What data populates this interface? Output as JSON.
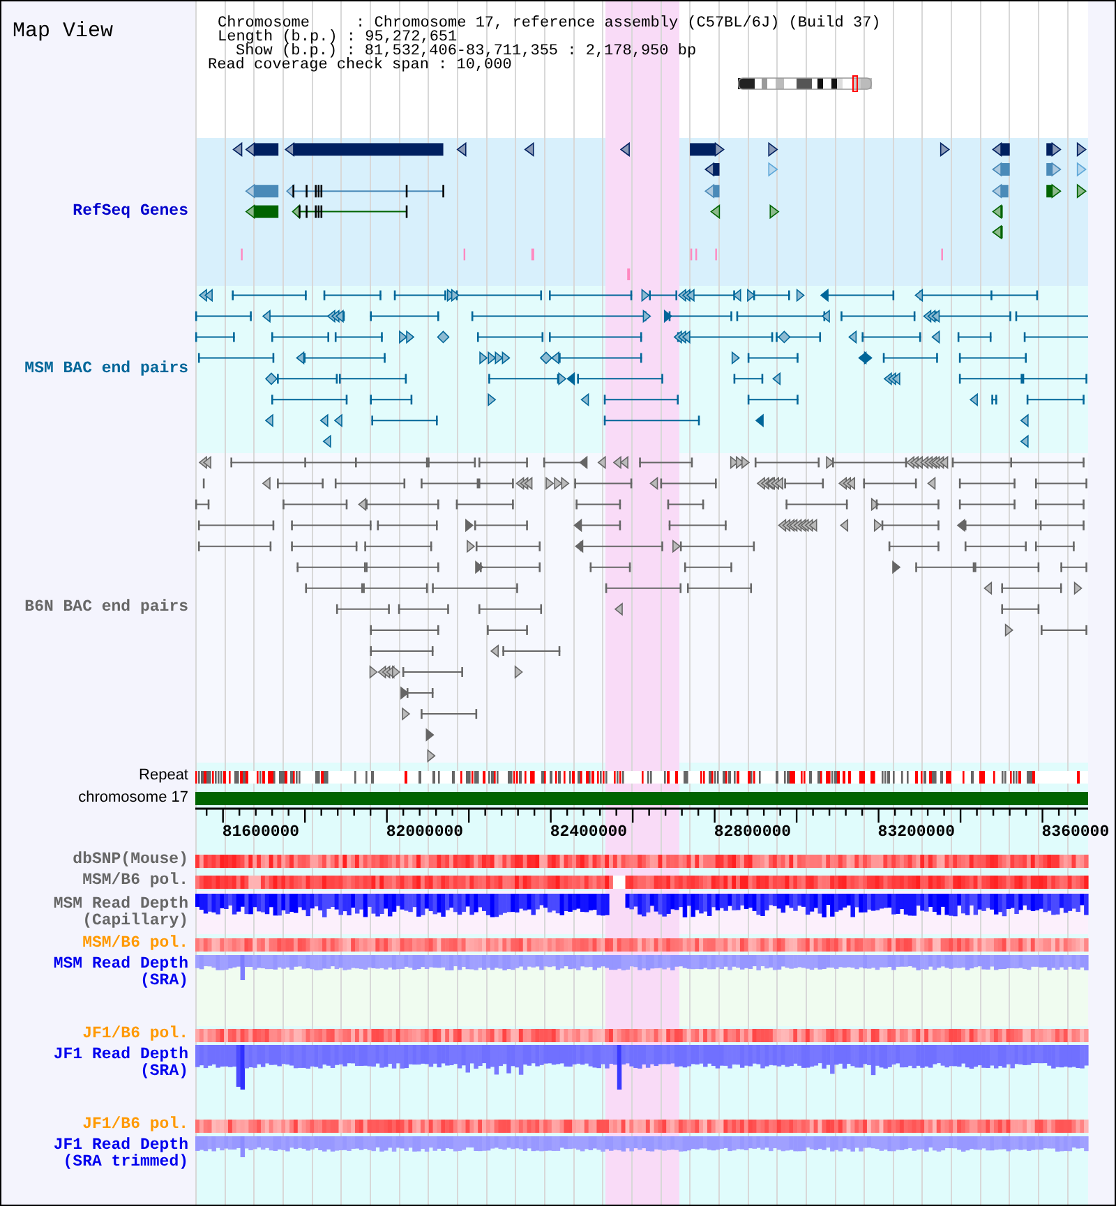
{
  "title": "Map View",
  "info_lines": [
    "Chromosome     : Chromosome 17, reference assembly (C57BL/6J) (Build 37)",
    "Length (b.p.) : 95,272,651",
    "Show (b.p.) : 81,532,406-83,711,355 : 2,178,950 bp",
    "Read coverage check span : 10,000"
  ],
  "tracks": [
    {
      "kind": "genes",
      "label": "RefSeq Genes",
      "color": "#0000cc"
    },
    {
      "kind": "bac",
      "label": "MSM BAC end pairs",
      "color": "#006699"
    },
    {
      "kind": "bac",
      "label": "B6N BAC end pairs",
      "color": "#666666"
    },
    {
      "kind": "repeat",
      "label": "Repeat"
    },
    {
      "kind": "chromosome",
      "label": "chromosome 17"
    },
    {
      "kind": "ruler",
      "tick_labels": [
        "81600000",
        "82000000",
        "82400000",
        "82800000",
        "83200000",
        "8360000"
      ]
    },
    {
      "kind": "heat",
      "label": "dbSNP(Mouse)",
      "color": "#666666"
    },
    {
      "kind": "heat",
      "label": "MSM/B6 pol.",
      "color": "#666666"
    },
    {
      "kind": "depth",
      "label": "MSM Read Depth (Capillary)",
      "color": "#666666"
    },
    {
      "kind": "heat",
      "label": "MSM/B6 pol.",
      "color": "#ff9900"
    },
    {
      "kind": "depth",
      "label": "MSM Read Depth (SRA)",
      "color": "#0000ee"
    },
    {
      "kind": "heat",
      "label": "JF1/B6 pol.",
      "color": "#ff9900"
    },
    {
      "kind": "depth",
      "label": "JF1 Read Depth (SRA)",
      "color": "#0000ee"
    },
    {
      "kind": "heat",
      "label": "JF1/B6 pol.",
      "color": "#ff9900"
    },
    {
      "kind": "depth",
      "label": "JF1 Read Depth (SRA trimmed)",
      "color": "#0000ee"
    }
  ]
}
